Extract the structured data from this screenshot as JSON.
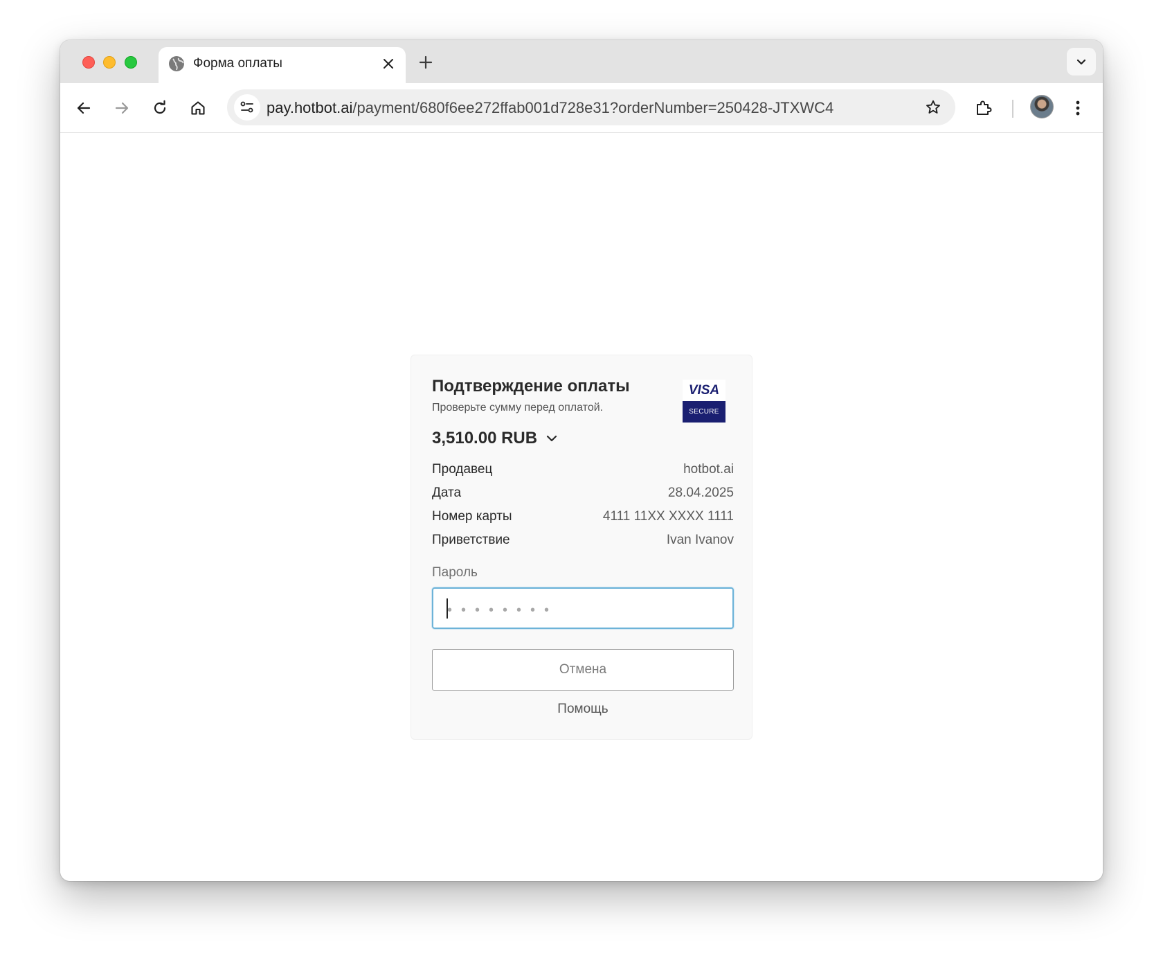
{
  "browser": {
    "tab": {
      "title": "Форма оплаты",
      "icon": "globe-icon"
    },
    "address": {
      "host": "pay.hotbot.ai",
      "path": "/payment/680f6ee272ffab001d728e31?orderNumber=250428-JTXWC4"
    },
    "icons": [
      "back-icon",
      "forward-icon",
      "reload-icon",
      "home-icon",
      "site-info-icon",
      "star-icon",
      "extensions-icon",
      "more-icon",
      "chevron-down-icon",
      "plus-icon",
      "close-icon"
    ]
  },
  "payment": {
    "title": "Подтверждение оплаты",
    "subtitle": "Проверьте сумму перед оплатой.",
    "logo": {
      "brand": "VISA",
      "tagline": "SECURE"
    },
    "amount": "3,510.00 RUB",
    "details": [
      {
        "label": "Продавец",
        "value": "hotbot.ai"
      },
      {
        "label": "Дата",
        "value": "28.04.2025"
      },
      {
        "label": "Номер карты",
        "value": "4111 11XX XXXX 1111"
      },
      {
        "label": "Приветствие",
        "value": "Ivan Ivanov"
      }
    ],
    "password_label": "Пароль",
    "password_placeholder": "••••••••",
    "cancel_label": "Отмена",
    "help_label": "Помощь"
  },
  "colors": {
    "visa_navy": "#1a1f71",
    "input_focus": "#6db3d8"
  }
}
